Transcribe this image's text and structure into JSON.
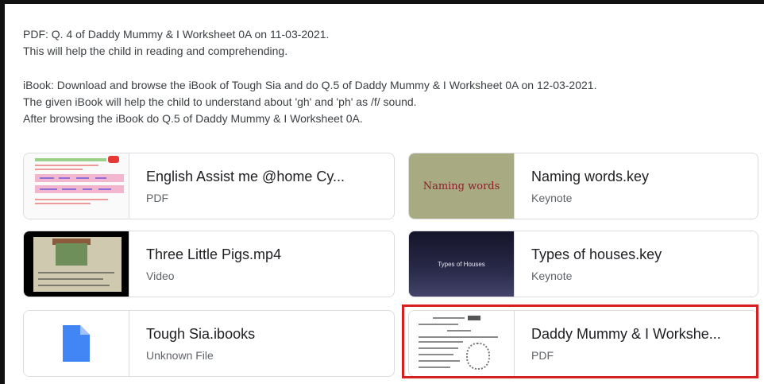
{
  "description": {
    "lines": [
      "PDF: Q. 4 of Daddy Mummy & I Worksheet 0A on 11-03-2021.",
      "This will help the child in reading and comprehending.",
      "iBook: Download and browse the iBook of Tough Sia and do Q.5 of Daddy Mummy & I Worksheet 0A on 12-03-2021.",
      "The given iBook will help the child to understand about 'gh' and 'ph' as /f/ sound.",
      "After browsing the iBook do Q.5 of Daddy Mummy & I Worksheet 0A."
    ]
  },
  "attachments": [
    {
      "title": "English Assist me @home Cy...",
      "type": "PDF",
      "thumbnail": "pdf-preview"
    },
    {
      "title": "Naming words.key",
      "type": "Keynote",
      "thumbnail_text": "Naming words",
      "thumbnail_color": "#a8ab82"
    },
    {
      "title": "Three Little Pigs.mp4",
      "type": "Video",
      "thumbnail": "video-preview"
    },
    {
      "title": "Types of houses.key",
      "type": "Keynote",
      "thumbnail_text": "Types of Houses",
      "thumbnail_color": "#2a2a4a"
    },
    {
      "title": "Tough Sia.ibooks",
      "type": "Unknown File",
      "thumbnail": "file-icon",
      "icon_color": "#4285f4"
    },
    {
      "title": "Daddy Mummy & I Workshe...",
      "type": "PDF",
      "thumbnail": "pdf-preview",
      "highlighted": true
    }
  ],
  "highlight_color": "#d71f1f"
}
